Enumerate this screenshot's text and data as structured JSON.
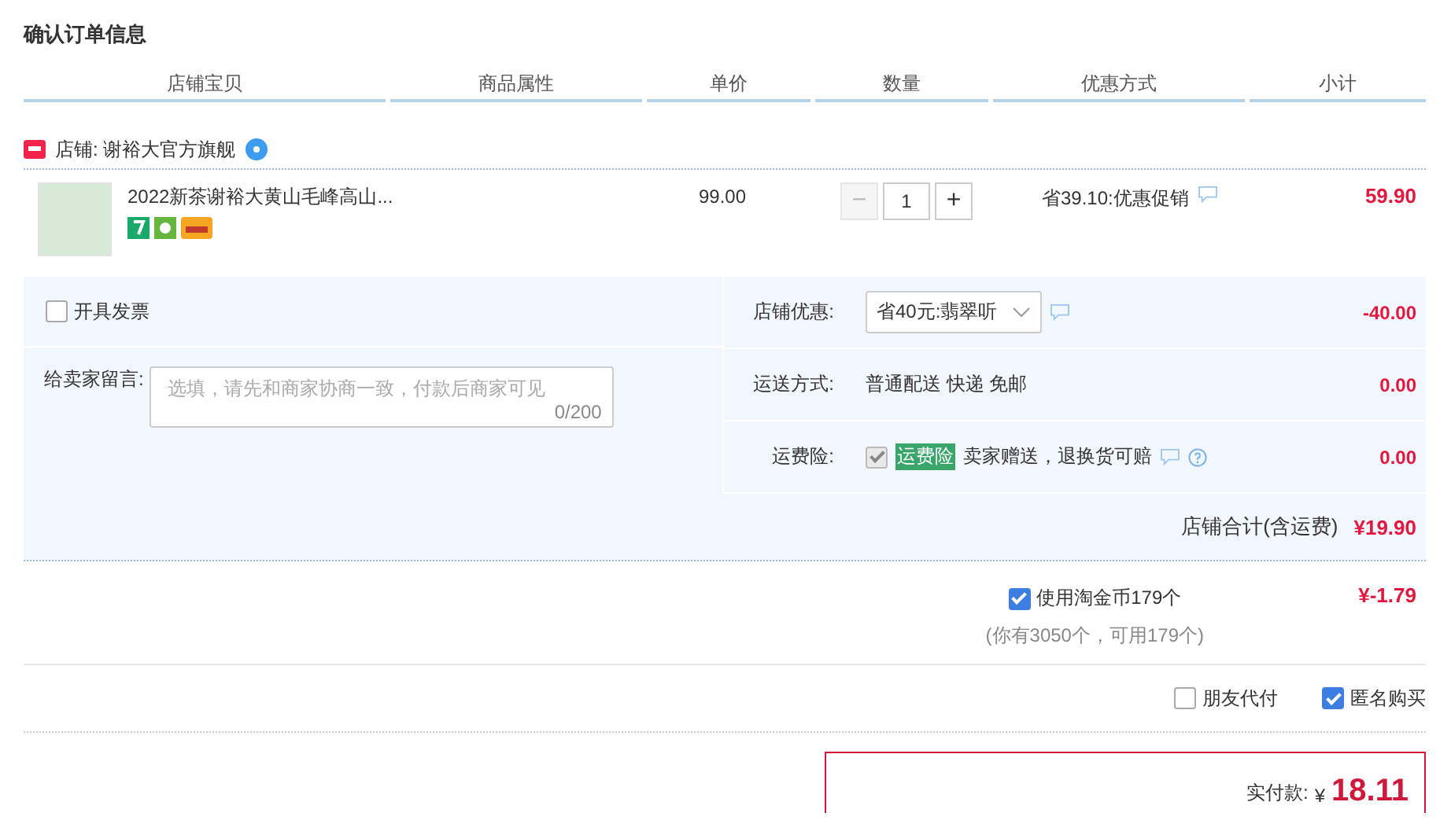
{
  "title": "确认订单信息",
  "columns": [
    "店铺宝贝",
    "商品属性",
    "单价",
    "数量",
    "优惠方式",
    "小计"
  ],
  "shop": {
    "label": "店铺: 谢裕大官方旗舰"
  },
  "item": {
    "title": "2022新茶谢裕大黄山毛峰高山...",
    "price": "99.00",
    "minus": "−",
    "quantity": "1",
    "plus": "+",
    "discount": "省39.10:优惠促销",
    "subtotal": "59.90"
  },
  "invoice": {
    "label": "开具发票",
    "checked": false
  },
  "message": {
    "label": "给卖家留言:",
    "placeholder": "选填，请先和商家协商一致，付款后商家可见",
    "counter": "0/200"
  },
  "shop_rows": [
    {
      "kind": "select",
      "label": "店铺优惠:",
      "value": "省40元:翡翠听",
      "amount": "-40.00"
    },
    {
      "kind": "text",
      "label": "运送方式:",
      "value": "普通配送 快递 免邮",
      "amount": "0.00"
    },
    {
      "kind": "insurance",
      "label": "运费险:",
      "checked": true,
      "disabled": true,
      "tag": "运费险",
      "value": "卖家赠送，退换货可赔",
      "amount": "0.00"
    }
  ],
  "shop_total": {
    "label": "店铺合计(含运费)",
    "amount": "¥19.90"
  },
  "coins": {
    "label": "使用淘金币179个",
    "checked": true,
    "note": "(你有3050个，可用179个)",
    "amount": "¥-1.79"
  },
  "options": [
    {
      "label": "朋友代付",
      "checked": false
    },
    {
      "label": "匿名购买",
      "checked": true
    }
  ],
  "pay": {
    "label": "实付款:",
    "currency": "¥",
    "amount": "18.11"
  }
}
